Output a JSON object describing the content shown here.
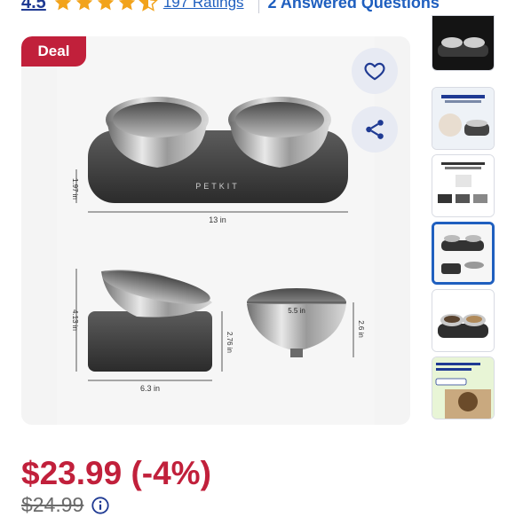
{
  "rating": {
    "value": "4.5",
    "stars_out_of_5": 4.5,
    "ratings_link": "197 Ratings",
    "answered_questions": "2 Answered Questions",
    "star_color": "#f2a31b"
  },
  "gallery": {
    "deal_badge": "Deal",
    "favorite_icon": "heart-outline-icon",
    "share_icon": "share-icon",
    "selected_thumbnail": 4,
    "image_texts": {
      "brand": "PETKIT",
      "height_small": "1.97 in",
      "width_total": "13 in",
      "side_height": "4.13 in",
      "base_height": "2.76 in",
      "base_width": "6.3 in",
      "bowl_diameter": "5.5 in",
      "bowl_depth": "2.6 in"
    }
  },
  "price": {
    "current": "$23.99 (-4%)",
    "was": "$24.99",
    "color": "#c1203b"
  }
}
